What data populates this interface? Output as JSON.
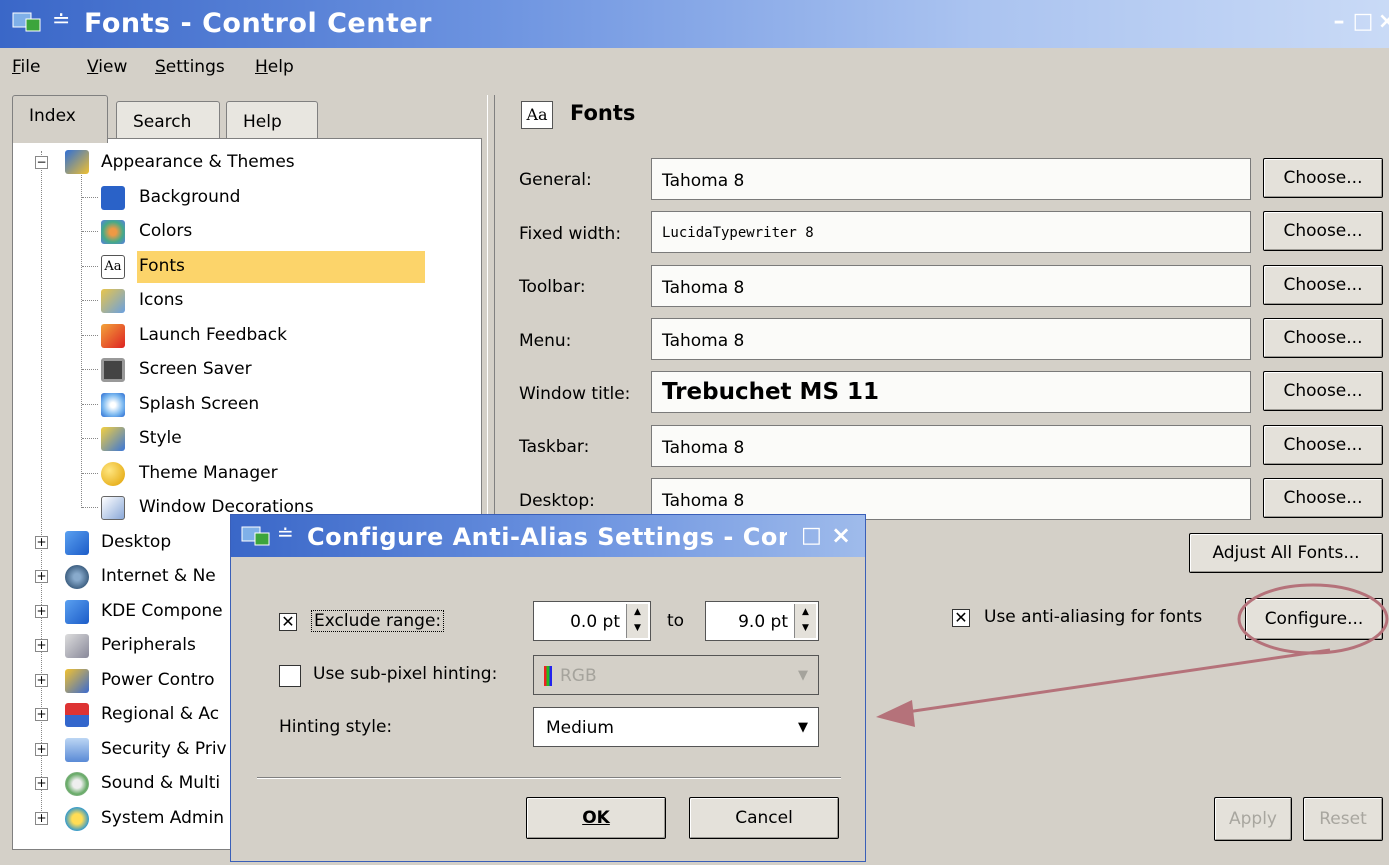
{
  "window": {
    "title": "Fonts - Control Center"
  },
  "menu": [
    {
      "prefix": "",
      "u": "F",
      "rest": "ile"
    },
    {
      "prefix": "",
      "u": "V",
      "rest": "iew"
    },
    {
      "prefix": "",
      "u": "S",
      "rest": "ettings"
    },
    {
      "prefix": "",
      "u": "H",
      "rest": "elp"
    }
  ],
  "tabs": {
    "index": "Index",
    "search": "Search",
    "help": "Help"
  },
  "tree": {
    "appearance": "Appearance & Themes",
    "children": [
      "Background",
      "Colors",
      "Fonts",
      "Icons",
      "Launch Feedback",
      "Screen Saver",
      "Splash Screen",
      "Style",
      "Theme Manager",
      "Window Decorations"
    ],
    "groups": [
      "Desktop",
      "Internet & Ne",
      "KDE Compone",
      "Peripherals",
      "Power Contro",
      "Regional & Ac",
      "Security & Priv",
      "Sound & Multi",
      "System Admin"
    ]
  },
  "page": {
    "icon_text": "Aa",
    "title": "Fonts"
  },
  "fonts": [
    {
      "label": "General:",
      "value": "Tahoma 8"
    },
    {
      "label": "Fixed width:",
      "value": "LucidaTypewriter 8"
    },
    {
      "label": "Toolbar:",
      "value": "Tahoma 8"
    },
    {
      "label": "Menu:",
      "value": "Tahoma 8"
    },
    {
      "label": "Window title:",
      "value": "Trebuchet MS 11"
    },
    {
      "label": "Taskbar:",
      "value": "Tahoma 8"
    },
    {
      "label": "Desktop:",
      "value": "Tahoma 8"
    }
  ],
  "buttons": {
    "choose": "Choose...",
    "adjust_all": "Adjust All Fonts...",
    "configure": "Configure...",
    "apply": "Apply",
    "reset": "Reset"
  },
  "antialias": {
    "label": "Use anti-aliasing for fonts",
    "checked": true
  },
  "dialog": {
    "title": "Configure Anti-Alias Settings - Contr",
    "exclude_label": "Exclude range:",
    "exclude_checked": true,
    "from": "0.0 pt",
    "to_label": "to",
    "to": "9.0 pt",
    "subpixel_label": "Use sub-pixel hinting:",
    "subpixel_checked": false,
    "subpixel_value": "RGB",
    "hinting_label": "Hinting style:",
    "hinting_value": "Medium",
    "ok": "OK",
    "cancel": "Cancel"
  },
  "colors": {
    "title_bar": "#3a67c8",
    "selection": "#fcd46a",
    "annotation": "#b5727a"
  }
}
